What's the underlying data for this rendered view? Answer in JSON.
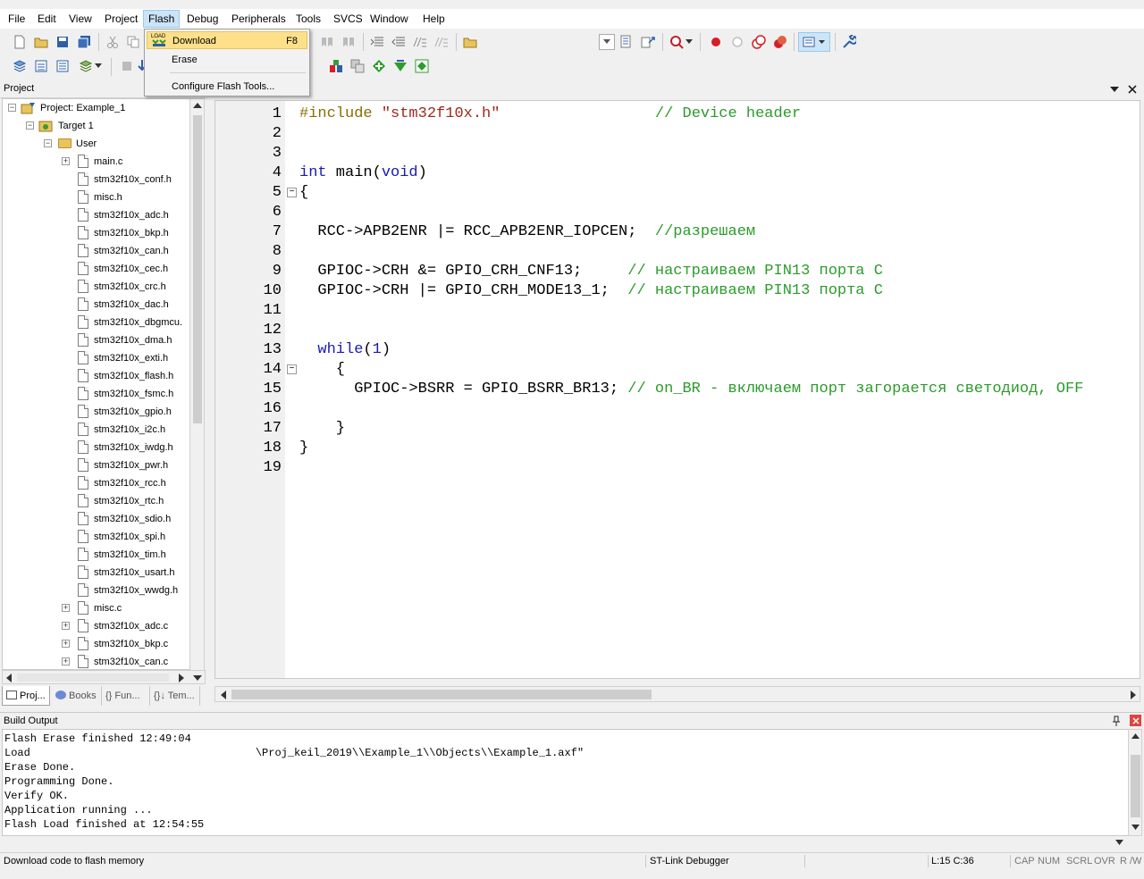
{
  "menubar": {
    "items": [
      "File",
      "Edit",
      "View",
      "Project",
      "Flash",
      "Debug",
      "Peripherals",
      "Tools",
      "SVCS",
      "Window",
      "Help"
    ]
  },
  "flash_menu": {
    "download_label": "Download",
    "download_shortcut": "F8",
    "download_badge": "LOAD",
    "erase_label": "Erase",
    "configure_label": "Configure Flash Tools..."
  },
  "project_pane": {
    "title": "Project",
    "root": "Project: Example_1",
    "target": "Target 1",
    "group": "User",
    "files": [
      "main.c",
      "stm32f10x_conf.h",
      "misc.h",
      "stm32f10x_adc.h",
      "stm32f10x_bkp.h",
      "stm32f10x_can.h",
      "stm32f10x_cec.h",
      "stm32f10x_crc.h",
      "stm32f10x_dac.h",
      "stm32f10x_dbgmcu.",
      "stm32f10x_dma.h",
      "stm32f10x_exti.h",
      "stm32f10x_flash.h",
      "stm32f10x_fsmc.h",
      "stm32f10x_gpio.h",
      "stm32f10x_i2c.h",
      "stm32f10x_iwdg.h",
      "stm32f10x_pwr.h",
      "stm32f10x_rcc.h",
      "stm32f10x_rtc.h",
      "stm32f10x_sdio.h",
      "stm32f10x_spi.h",
      "stm32f10x_tim.h",
      "stm32f10x_usart.h",
      "stm32f10x_wwdg.h",
      "misc.c",
      "stm32f10x_adc.c",
      "stm32f10x_bkp.c",
      "stm32f10x_can.c"
    ],
    "tabs": [
      "Proj...",
      "Books",
      "{} Fun...",
      "{}↓ Tem..."
    ]
  },
  "editor": {
    "lines": [
      {
        "n": "1",
        "text": "#include \"stm32f10x.h\"                 // Device header"
      },
      {
        "n": "2",
        "text": ""
      },
      {
        "n": "3",
        "text": ""
      },
      {
        "n": "4",
        "text": "int main(void)"
      },
      {
        "n": "5",
        "text": "{"
      },
      {
        "n": "6",
        "text": ""
      },
      {
        "n": "7",
        "text": "  RCC->APB2ENR |= RCC_APB2ENR_IOPCEN;  //разрешаем"
      },
      {
        "n": "8",
        "text": ""
      },
      {
        "n": "9",
        "text": "  GPIOC->CRH &= GPIO_CRH_CNF13;     // настраиваем PIN13 порта C"
      },
      {
        "n": "10",
        "text": "  GPIOC->CRH |= GPIO_CRH_MODE13_1;  // настраиваем PIN13 порта C"
      },
      {
        "n": "11",
        "text": ""
      },
      {
        "n": "12",
        "text": ""
      },
      {
        "n": "13",
        "text": "  while(1)"
      },
      {
        "n": "14",
        "text": "    {"
      },
      {
        "n": "15",
        "text": "      GPIOC->BSRR = GPIO_BSRR_BR13; // on_BR - включаем порт загорается светодиод, OFF"
      },
      {
        "n": "16",
        "text": ""
      },
      {
        "n": "17",
        "text": "    }"
      },
      {
        "n": "18",
        "text": "}"
      },
      {
        "n": "19",
        "text": ""
      }
    ]
  },
  "build_output": {
    "title": "Build Output",
    "lines": [
      "Flash Erase finished 12:49:04",
      "Load                                   \\Proj_keil_2019\\\\Example_1\\\\Objects\\\\Example_1.axf\"",
      "Erase Done.",
      "Programming Done.",
      "Verify OK.",
      "Application running ...",
      "Flash Load finished at 12:54:55"
    ]
  },
  "statusbar": {
    "message": "Download code to flash memory",
    "debugger": "ST-Link Debugger",
    "position": "L:15 C:36",
    "indicators": [
      "CAP",
      "NUM",
      "SCRL",
      "OVR",
      "R /W"
    ]
  },
  "colors": {
    "keyword": "#1a1ab4",
    "string": "#a0291b",
    "comment": "#2c9b2c",
    "preprocessor": "#8b6d00",
    "menu_highlight": "#fde089"
  }
}
